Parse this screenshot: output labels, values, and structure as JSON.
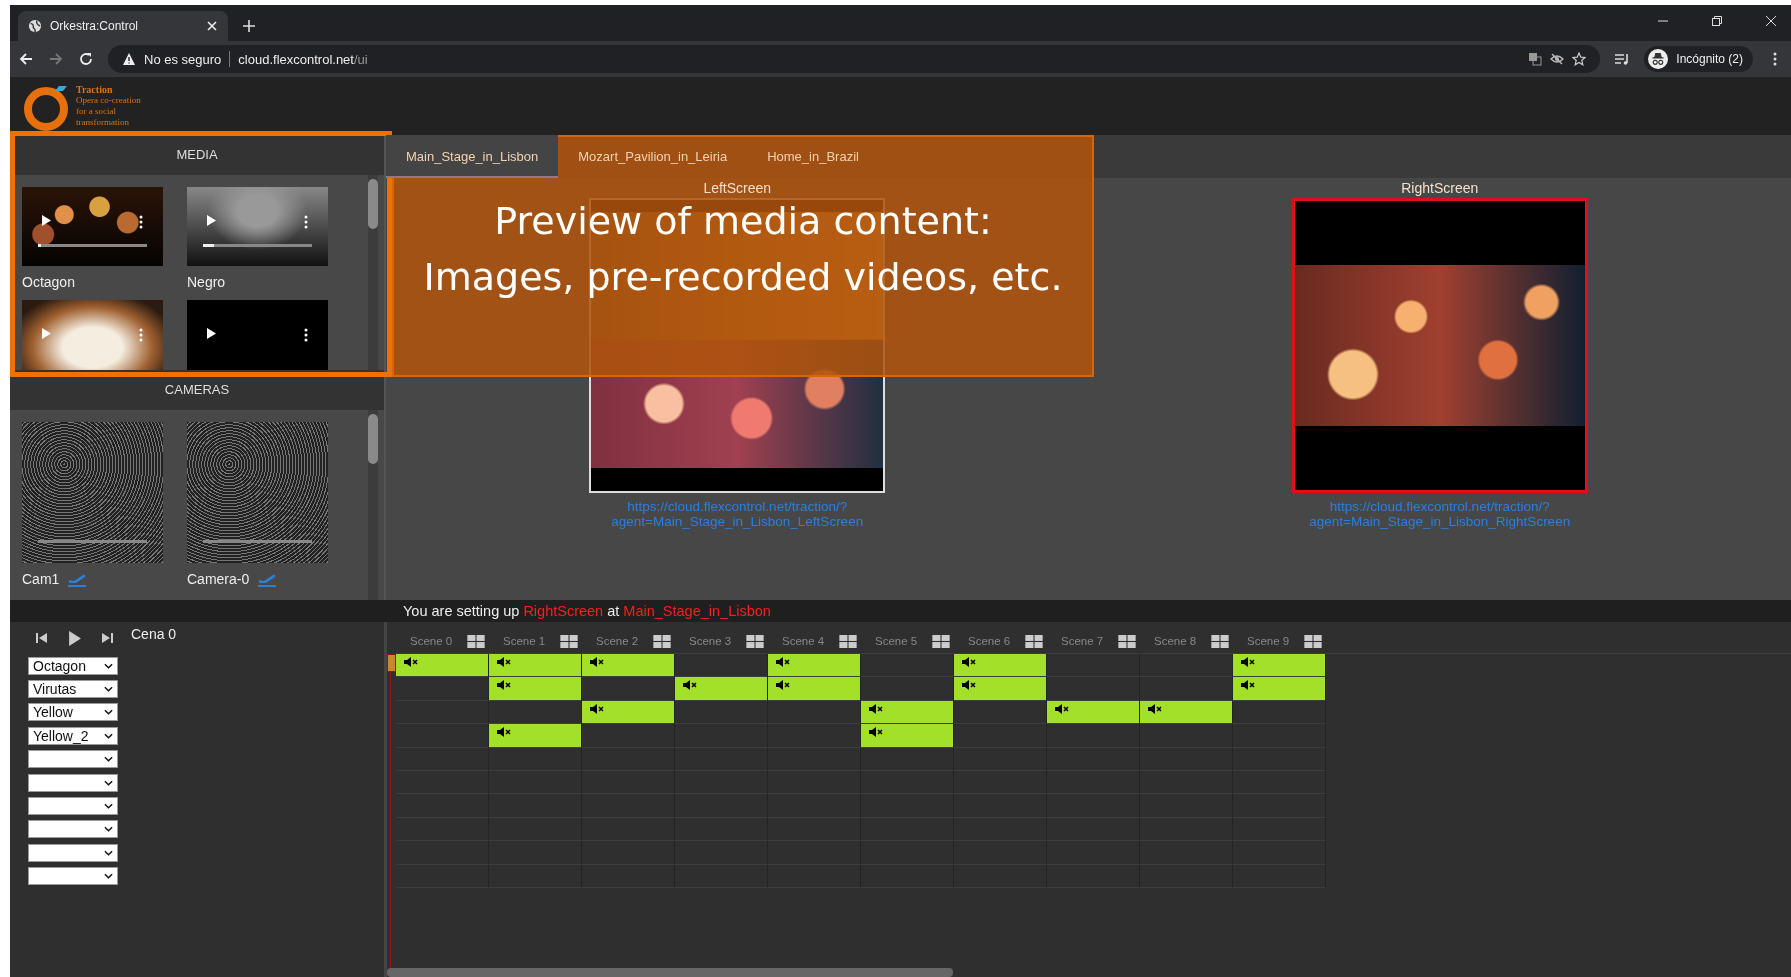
{
  "browser": {
    "tab_title": "Orkestra:Control",
    "security": "No es seguro",
    "url_host": "cloud.flexcontrol.net",
    "url_path": "/ui",
    "profile": "Incógnito (2)"
  },
  "logo": {
    "title": "Traction",
    "tagline": "Opera co-creation for a social transformation"
  },
  "media": {
    "title": "MEDIA",
    "items": [
      {
        "name": "Octagon",
        "kind": "bokeh",
        "level": 0.03
      },
      {
        "name": "Negro",
        "kind": "smoke",
        "level": 0.1
      },
      {
        "kind": "glow"
      },
      {
        "kind": "black"
      }
    ]
  },
  "cameras": {
    "title": "CAMERAS",
    "items": [
      {
        "name": "Cam1"
      },
      {
        "name": "Camera-0"
      }
    ]
  },
  "tabs": [
    {
      "label": "Main_Stage_in_Lisbon",
      "selected": true
    },
    {
      "label": "Mozart_Pavilion_in_Leiria",
      "selected": false
    },
    {
      "label": "Home_in_Brazil",
      "selected": false
    }
  ],
  "screens": [
    {
      "label": "LeftScreen",
      "selected": false,
      "kind": "scenes",
      "url_lines": [
        "https://cloud.flexcontrol.net/traction/?",
        "agent=Main_Stage_in_Lisbon_LeftScreen"
      ]
    },
    {
      "label": "RightScreen",
      "selected": true,
      "kind": "bokeh",
      "url_lines": [
        "https://cloud.flexcontrol.net/traction/?",
        "agent=Main_Stage_in_Lisbon_RightScreen"
      ]
    }
  ],
  "status": {
    "prefix": "You are setting up",
    "screen": "RightScreen",
    "joiner": "at",
    "stage": "Main_Stage_in_Lisbon"
  },
  "timeline": {
    "scene_name": "Cena 0",
    "scenes": [
      "Scene 0",
      "Scene 1",
      "Scene 2",
      "Scene 3",
      "Scene 4",
      "Scene 5",
      "Scene 6",
      "Scene 7",
      "Scene 8",
      "Scene 9"
    ],
    "tracks": [
      {
        "value": "Octagon",
        "clips": [
          true,
          true,
          true,
          false,
          true,
          false,
          true,
          false,
          false,
          true
        ]
      },
      {
        "value": "Virutas",
        "clips": [
          false,
          true,
          false,
          true,
          true,
          false,
          true,
          false,
          false,
          true
        ]
      },
      {
        "value": "Yellow",
        "clips": [
          false,
          false,
          true,
          false,
          false,
          true,
          false,
          true,
          true,
          false
        ]
      },
      {
        "value": "Yellow_2",
        "clips": [
          false,
          true,
          false,
          false,
          false,
          true,
          false,
          false,
          false,
          false
        ]
      },
      {
        "clips": [
          false,
          false,
          false,
          false,
          false,
          false,
          false,
          false,
          false,
          false
        ]
      },
      {
        "clips": [
          false,
          false,
          false,
          false,
          false,
          false,
          false,
          false,
          false,
          false
        ]
      },
      {
        "clips": [
          false,
          false,
          false,
          false,
          false,
          false,
          false,
          false,
          false,
          false
        ]
      },
      {
        "clips": [
          false,
          false,
          false,
          false,
          false,
          false,
          false,
          false,
          false,
          false
        ]
      },
      {
        "clips": [
          false,
          false,
          false,
          false,
          false,
          false,
          false,
          false,
          false,
          false
        ]
      },
      {
        "clips": [
          false,
          false,
          false,
          false,
          false,
          false,
          false,
          false,
          false,
          false
        ]
      }
    ]
  },
  "annotation": {
    "lines": [
      "Preview of media content:",
      "Images, pre-recorded videos, etc."
    ]
  }
}
